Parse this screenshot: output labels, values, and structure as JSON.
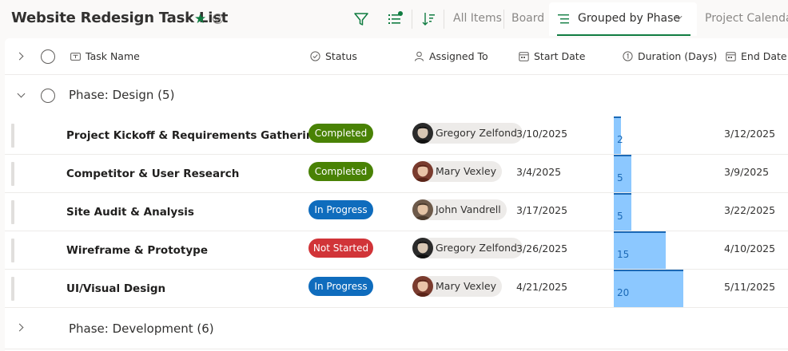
{
  "header": {
    "title": "Website Redesign Task List",
    "views": {
      "all_items": "All Items",
      "board": "Board",
      "grouped": "Grouped by Phase",
      "calendar": "Project Calendar"
    }
  },
  "columns": {
    "task_name": "Task Name",
    "status": "Status",
    "assigned_to": "Assigned To",
    "start_date": "Start Date",
    "duration": "Duration (Days)",
    "end_date": "End Date"
  },
  "groups": [
    {
      "label": "Phase: Design (5)",
      "expanded": true
    },
    {
      "label": "Phase: Development (6)",
      "expanded": false
    }
  ],
  "rows": [
    {
      "task": "Project Kickoff & Requirements Gathering",
      "status": "Completed",
      "status_color": "#498205",
      "assignee": "Gregory Zelfond",
      "start": "3/10/2025",
      "duration": 2,
      "duration_label": "2",
      "end": "3/12/2025"
    },
    {
      "task": "Competitor & User Research",
      "status": "Completed",
      "status_color": "#498205",
      "assignee": "Mary Vexley",
      "start": "3/4/2025",
      "duration": 5,
      "duration_label": "5",
      "end": "3/9/2025"
    },
    {
      "task": "Site Audit & Analysis",
      "status": "In Progress",
      "status_color": "#0f6cbd",
      "assignee": "John Vandrell",
      "start": "3/17/2025",
      "duration": 5,
      "duration_label": "5",
      "end": "3/22/2025"
    },
    {
      "task": "Wireframe & Prototype",
      "status": "Not Started",
      "status_color": "#d13438",
      "assignee": "Gregory Zelfond",
      "start": "3/26/2025",
      "duration": 15,
      "duration_label": "15",
      "end": "4/10/2025"
    },
    {
      "task": "UI/Visual Design",
      "status": "In Progress",
      "status_color": "#0f6cbd",
      "assignee": "Mary Vexley",
      "start": "4/21/2025",
      "duration": 20,
      "duration_label": "20",
      "end": "5/11/2025"
    }
  ],
  "colors": {
    "accent": "#107c41",
    "bar_fill": "#8cc8ff",
    "bar_edge": "#1b69b6"
  }
}
